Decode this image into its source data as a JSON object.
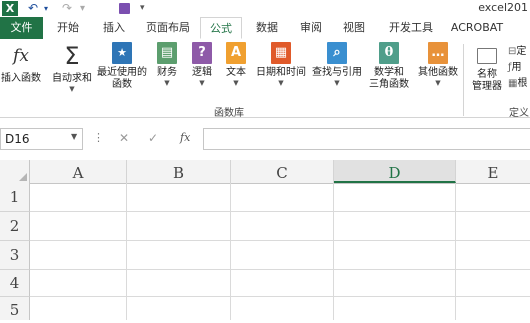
{
  "titlebar": {
    "app_logo": "X",
    "undo_icon": "undo-icon",
    "redo_icon": "redo-icon",
    "save_icon": "save-icon",
    "customize_icon": "customize-qat-icon",
    "window_title": "excel201"
  },
  "tabs": [
    "文件",
    "开始",
    "插入",
    "页面布局",
    "公式",
    "数据",
    "审阅",
    "视图",
    "开发工具",
    "ACROBAT"
  ],
  "active_tab": "公式",
  "ribbon": {
    "insert_function": {
      "icon": "fx",
      "label": "插入函数"
    },
    "autosum": {
      "icon": "Σ",
      "label": "自动求和"
    },
    "recent": {
      "icon": "★",
      "label_line1": "最近使用的",
      "label_line2": "函数"
    },
    "financial": {
      "icon": "▤",
      "label": "财务"
    },
    "logical": {
      "icon": "?",
      "label": "逻辑"
    },
    "text": {
      "icon": "A",
      "label": "文本"
    },
    "datetime": {
      "icon": "▦",
      "label": "日期和时间"
    },
    "lookup": {
      "icon": "⌕",
      "label": "查找与引用"
    },
    "math": {
      "icon": "θ",
      "label_line1": "数学和",
      "label_line2": "三角函数"
    },
    "more": {
      "icon": "…",
      "label": "其他函数"
    },
    "name_manager": {
      "label_line1": "名称",
      "label_line2": "管理器"
    },
    "define_items": [
      "定",
      "用",
      "根"
    ],
    "group_label": "函数库",
    "define_group_label": "定义"
  },
  "formula_bar": {
    "name_box": "D16",
    "cancel_icon": "✕",
    "enter_icon": "✓",
    "fx_icon": "fx",
    "value": ""
  },
  "grid": {
    "columns": [
      "A",
      "B",
      "C",
      "D",
      "E"
    ],
    "rows": [
      "1",
      "2",
      "3",
      "4",
      "5"
    ],
    "selected_column": "D"
  },
  "colors": {
    "excel_green": "#217346",
    "ribbon_icon_blue": "#2e75b6",
    "financial_green": "#5c9e6e",
    "logical_purple": "#8e5aa8",
    "text_orange": "#f0a030",
    "datetime_red": "#e05a2a",
    "lookup_blue": "#3a8fd0",
    "math_teal": "#4f9e8a",
    "more_orange": "#e8923a"
  }
}
